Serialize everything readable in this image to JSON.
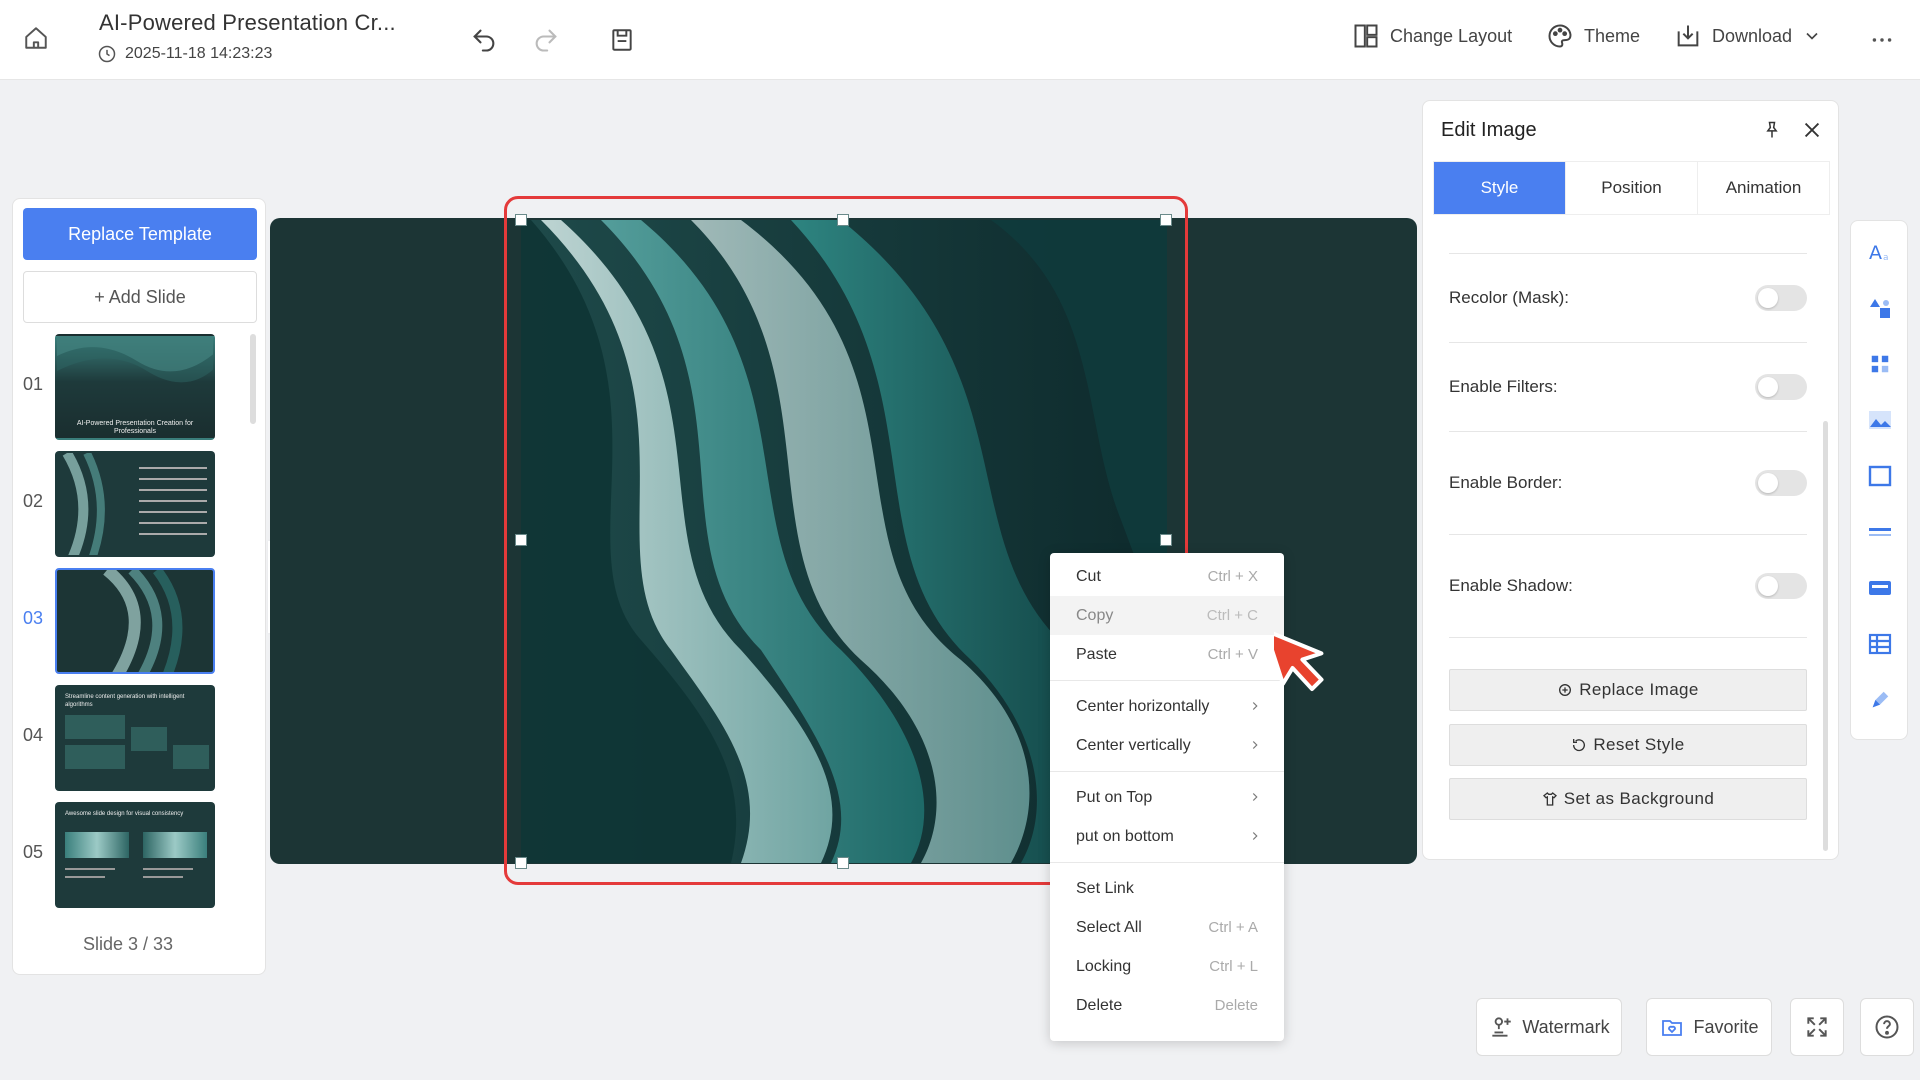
{
  "header": {
    "title": "AI-Powered Presentation Cr...",
    "timestamp": "2025-11-18 14:23:23",
    "change_layout": "Change Layout",
    "theme": "Theme",
    "download": "Download"
  },
  "left_panel": {
    "replace_template": "Replace Template",
    "add_slide": "+ Add Slide",
    "slides": [
      {
        "num": "01",
        "caption": "AI-Powered Presentation Creation for Professionals"
      },
      {
        "num": "02",
        "caption": ""
      },
      {
        "num": "03",
        "caption": ""
      },
      {
        "num": "04",
        "caption": "Streamline content generation with intelligent algorithms"
      },
      {
        "num": "05",
        "caption": "Awesome slide design for visual consistency"
      }
    ],
    "slide_count": "Slide 3 / 33"
  },
  "context_menu": {
    "cut": "Cut",
    "cut_sc": "Ctrl + X",
    "copy": "Copy",
    "copy_sc": "Ctrl + C",
    "paste": "Paste",
    "paste_sc": "Ctrl + V",
    "center_h": "Center horizontally",
    "center_v": "Center vertically",
    "put_top": "Put on Top",
    "put_bottom": "put on bottom",
    "set_link": "Set Link",
    "select_all": "Select All",
    "select_all_sc": "Ctrl + A",
    "locking": "Locking",
    "locking_sc": "Ctrl + L",
    "delete": "Delete",
    "delete_sc": "Delete"
  },
  "edit_panel": {
    "title": "Edit Image",
    "tabs": [
      "Style",
      "Position",
      "Animation"
    ],
    "recolor": "Recolor (Mask):",
    "filters": "Enable Filters:",
    "border": "Enable Border:",
    "shadow": "Enable Shadow:",
    "replace_image": "Replace Image",
    "reset_style": "Reset Style",
    "set_background": "Set as Background"
  },
  "bottom": {
    "watermark": "Watermark",
    "favorite": "Favorite"
  },
  "colors": {
    "accent": "#4a7ff0",
    "selection": "#e43a3a",
    "canvas_bg": "#1c3535"
  }
}
